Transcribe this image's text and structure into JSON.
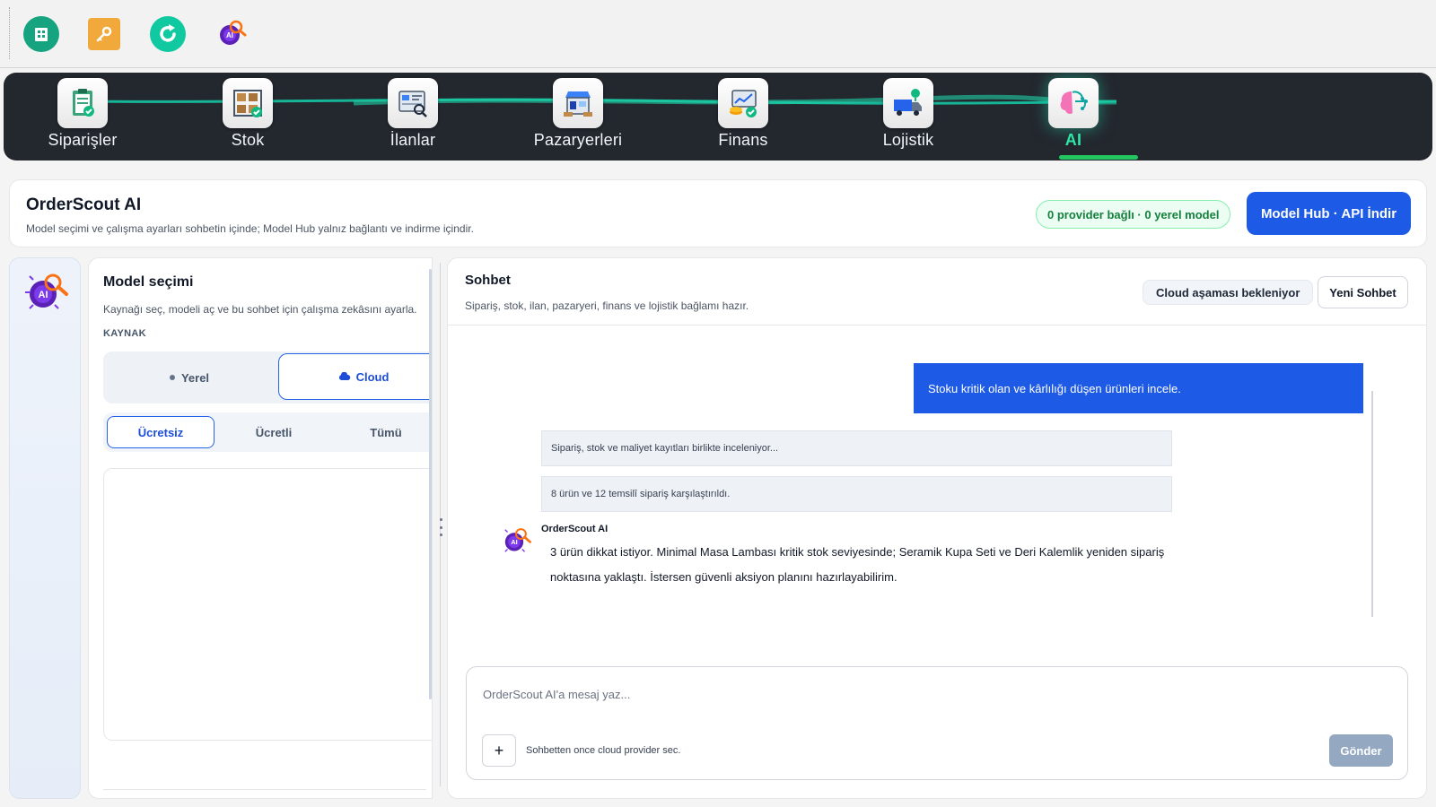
{
  "toolbar": {
    "icons": [
      "building-icon",
      "key-icon",
      "refresh-icon",
      "ai-icon"
    ]
  },
  "nav": {
    "items": [
      {
        "label": "Siparişler",
        "icon": "orders-icon"
      },
      {
        "label": "Stok",
        "icon": "stock-icon"
      },
      {
        "label": "İlanlar",
        "icon": "listings-icon"
      },
      {
        "label": "Pazaryerleri",
        "icon": "marketplaces-icon"
      },
      {
        "label": "Finans",
        "icon": "finance-icon"
      },
      {
        "label": "Lojistik",
        "icon": "logistics-icon"
      },
      {
        "label": "AI",
        "icon": "ai-brain-icon",
        "active": true
      }
    ],
    "accent": "#2ee6a6"
  },
  "header": {
    "title": "OrderScout AI",
    "subtitle": "Model seçimi ve çalışma ayarları sohbetin içinde; Model Hub yalnız bağlantı ve indirme içindir.",
    "status": "0 provider bağlı · 0 yerel model",
    "hub_button": "Model Hub · API  İndir"
  },
  "model_panel": {
    "title": "Model seçimi",
    "subtitle": "Kaynağı seç, modeli aç ve bu sohbet için çalışma zekâsını ayarla.",
    "section_label": "KAYNAK",
    "source_options": {
      "local": "Yerel",
      "cloud": "Cloud",
      "selected": "cloud"
    },
    "price_tabs": {
      "free": "Ücretsiz",
      "paid": "Ücretli",
      "all": "Tümü",
      "selected": "free"
    }
  },
  "chat": {
    "title": "Sohbet",
    "subtitle": "Sipariş, stok, ilan, pazaryeri, finans ve lojistik bağlamı hazır.",
    "cloud_status": "Cloud aşaması bekleniyor",
    "new_chat": "Yeni Sohbet",
    "messages": {
      "user": "Stoku kritik olan ve kârlılığı düşen ürünleri incele.",
      "step1": "Sipariş, stok ve maliyet kayıtları birlikte inceleniyor...",
      "step2": "8 ürün ve 12 temsilî sipariş karşılaştırıldı.",
      "ai_name": "OrderScout AI",
      "ai_text": "3 ürün dikkat istiyor. Minimal Masa Lambası kritik stok seviyesinde; Seramik Kupa Seti ve Deri Kalemlik yeniden sipariş noktasına yaklaştı. İstersen güvenli aksiyon planını hazırlayabilirim."
    },
    "composer": {
      "placeholder": "OrderScout AI'a mesaj yaz...",
      "attach": "+",
      "hint": "Sohbetten once cloud provider sec.",
      "send": "Gönder"
    }
  },
  "colors": {
    "primary": "#1d5ae6",
    "nav_bg": "#23272e",
    "success": "#15803d",
    "send_disabled": "#94a8c2"
  }
}
